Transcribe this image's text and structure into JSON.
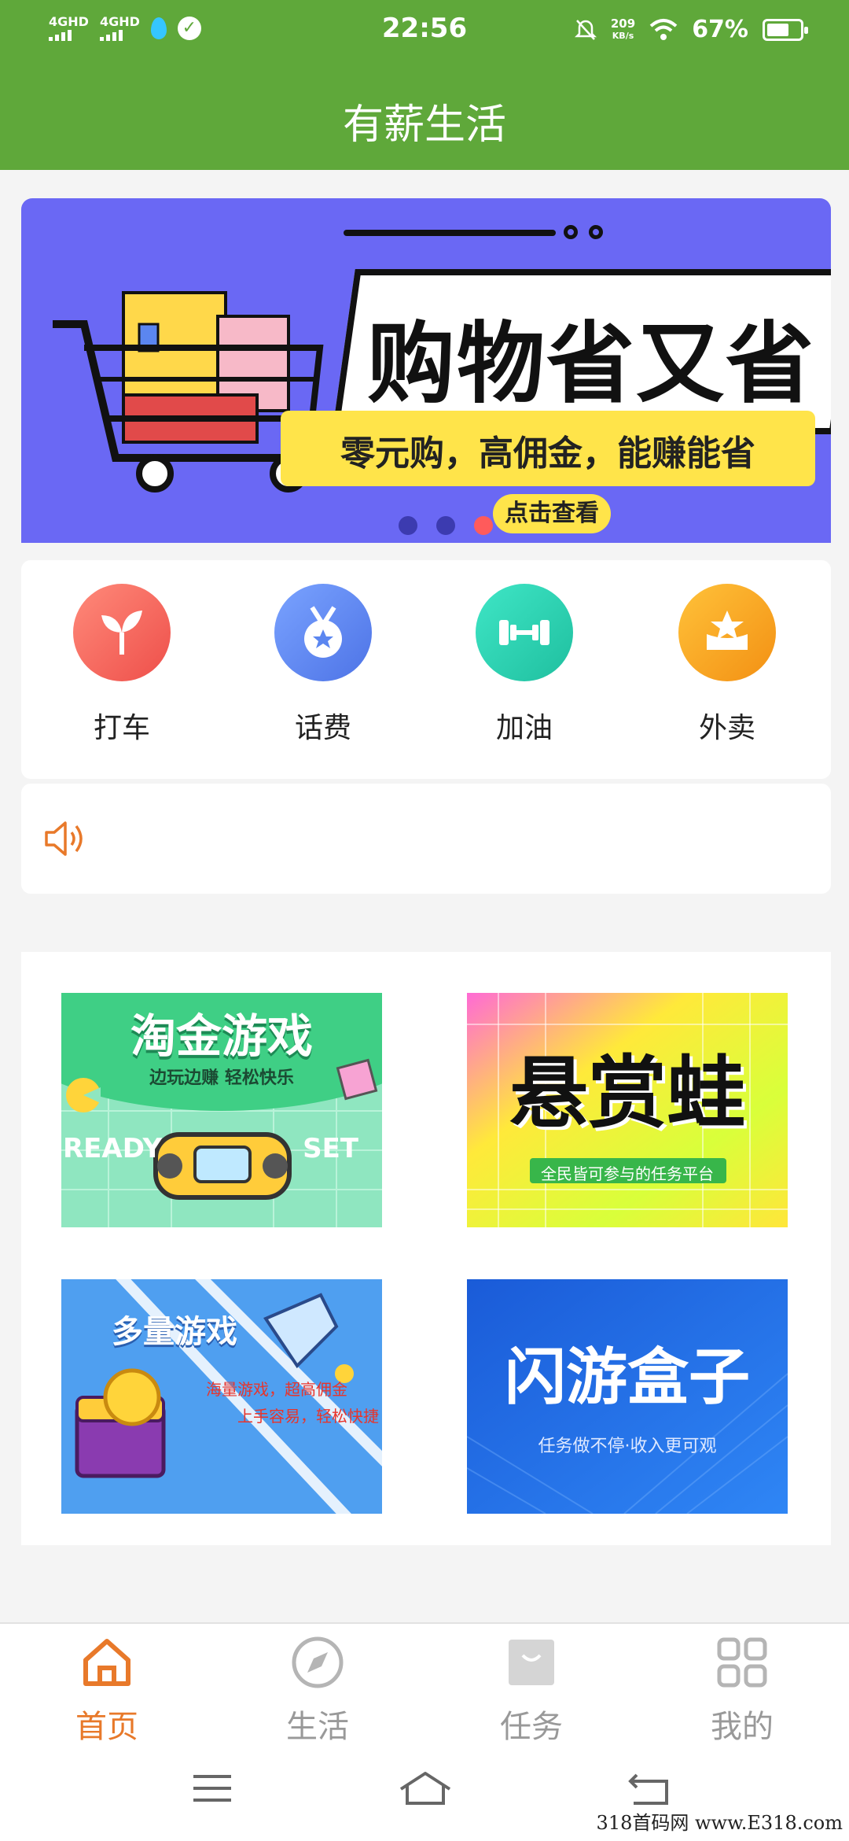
{
  "status_bar": {
    "sim1": "4GHD",
    "sim2": "4GHD",
    "time": "22:56",
    "net_speed_value": "209",
    "net_speed_unit": "KB/s",
    "battery": "67%",
    "battery_level": 0.67
  },
  "header": {
    "title": "有薪生活"
  },
  "banner": {
    "title": "购物省又省",
    "subtitle": "零元购，高佣金，能赚能省",
    "cta": "点击查看",
    "slide_count": 3,
    "active_slide": 3,
    "background": "#6a68f4"
  },
  "quick_actions": [
    {
      "label": "打车",
      "icon": "sprout-icon",
      "color": "#f26a5f"
    },
    {
      "label": "话费",
      "icon": "medal-icon",
      "color": "#5b86f0"
    },
    {
      "label": "加油",
      "icon": "dumbbell-icon",
      "color": "#27d1b4"
    },
    {
      "label": "外卖",
      "icon": "star-badge-icon",
      "color": "#f7a21b"
    }
  ],
  "notice": {
    "icon": "speaker-icon",
    "text": ""
  },
  "games": [
    {
      "title": "淘金游戏",
      "subtitle": "边玩边赚 轻松快乐",
      "extra_left": "READY",
      "extra_right": "SET"
    },
    {
      "title": "悬赏蛙",
      "subtitle": "全民皆可参与的任务平台"
    },
    {
      "title": "多量游戏",
      "subtitle": "海量游戏，超高佣金",
      "subtitle2": "上手容易，轻松快捷"
    },
    {
      "title": "闪游盒子",
      "subtitle": "任务做不停·收入更可观"
    }
  ],
  "bottom_nav": [
    {
      "label": "首页",
      "icon": "home-icon",
      "active": true
    },
    {
      "label": "生活",
      "icon": "compass-icon",
      "active": false
    },
    {
      "label": "任务",
      "icon": "bag-icon",
      "active": false
    },
    {
      "label": "我的",
      "icon": "grid-icon",
      "active": false
    }
  ],
  "colors": {
    "primary": "#5fa83a",
    "accent": "#e8792a"
  },
  "watermark": "318首码网 www.E318.com"
}
